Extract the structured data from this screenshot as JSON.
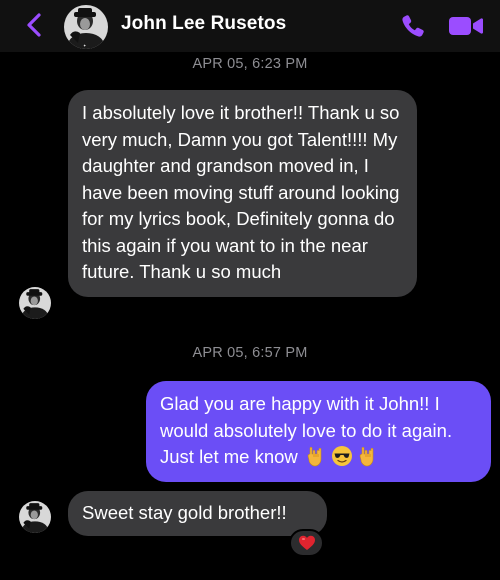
{
  "header": {
    "contact_name": "John Lee Rusetos",
    "back_icon": "chevron-left-icon",
    "call_icon": "phone-icon",
    "video_icon": "video-camera-icon",
    "accent_color": "#9b4dff"
  },
  "conversation": {
    "timestamps": [
      "APR 05, 6:23 PM",
      "APR 05, 6:57 PM"
    ],
    "messages": [
      {
        "sender": "John Lee Rusetos",
        "direction": "incoming",
        "text": "I absolutely love it brother!! Thank u so very much, Damn you got Talent!!!! My daughter and grandson moved in, I have been moving stuff around looking for my lyrics book, Definitely gonna do this again if you want to in the near future. Thank u so much"
      },
      {
        "direction": "outgoing",
        "text": "Glad you are happy with it John!! I would absolutely love to do it again. Just let me know",
        "emojis": [
          "rock-on-hand-icon",
          "sunglasses-face-icon",
          "rock-on-hand-icon"
        ]
      },
      {
        "sender": "John Lee Rusetos",
        "direction": "incoming",
        "text": "Sweet stay gold brother!!",
        "reaction": "red-heart-icon"
      }
    ]
  },
  "colors": {
    "incoming_bubble": "#3a3a3c",
    "outgoing_bubble": "#6b4ef6",
    "timestamp_text": "#8e8e93",
    "background": "#000000"
  }
}
